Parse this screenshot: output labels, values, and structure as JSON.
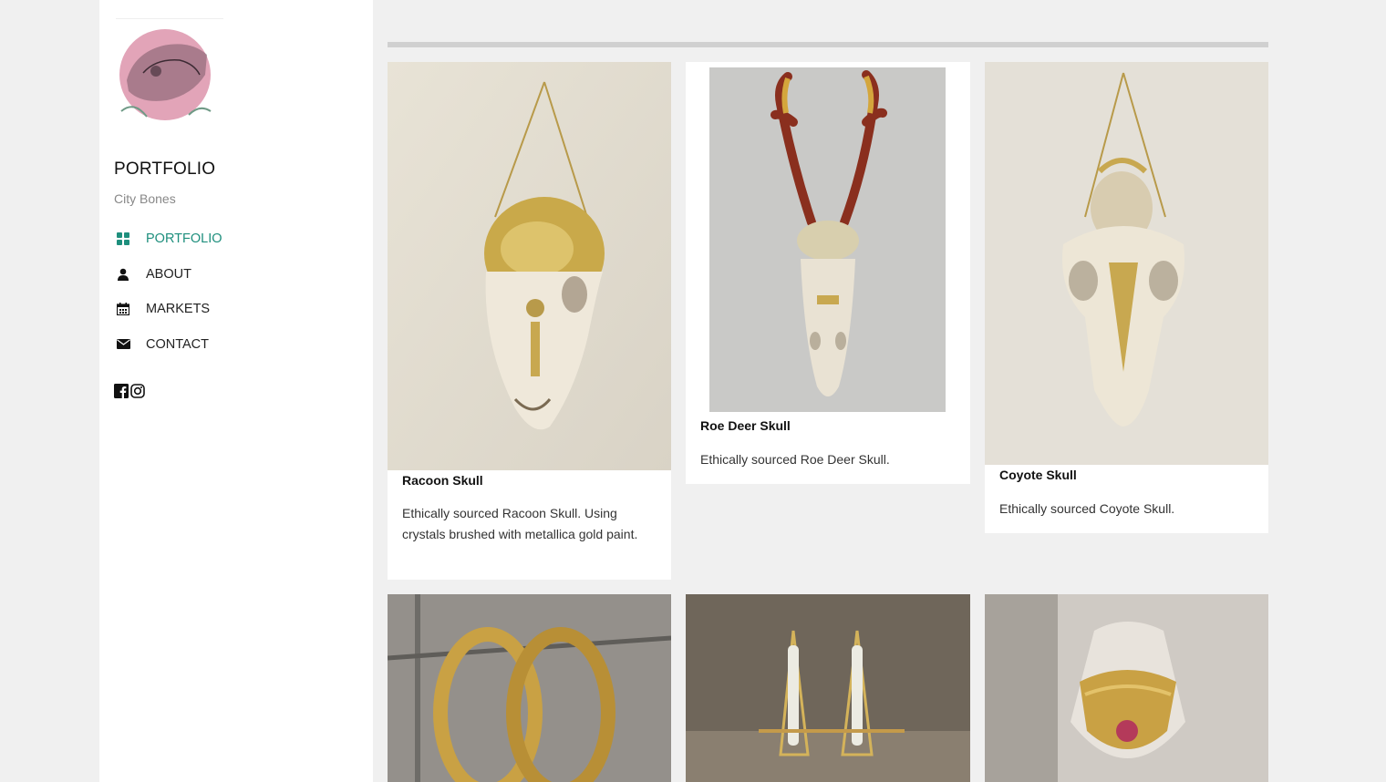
{
  "site": {
    "title": "PORTFOLIO",
    "subtitle": "City Bones",
    "logo_text": "City Bones"
  },
  "nav": [
    {
      "label": "PORTFOLIO",
      "icon": "grid-icon",
      "active": true
    },
    {
      "label": "ABOUT",
      "icon": "user-icon",
      "active": false
    },
    {
      "label": "MARKETS",
      "icon": "calendar-icon",
      "active": false
    },
    {
      "label": "CONTACT",
      "icon": "envelope-icon",
      "active": false
    }
  ],
  "social": [
    "facebook-icon",
    "instagram-icon"
  ],
  "colors": {
    "accent": "#1e8f7d",
    "background": "#f0f0f0"
  },
  "items": [
    {
      "title": "Racoon Skull",
      "description": "Ethically sourced Racoon Skull. Using crystals brushed with metallica gold paint."
    },
    {
      "title": "Roe Deer Skull",
      "description": "Ethically sourced Roe Deer Skull."
    },
    {
      "title": "Coyote Skull",
      "description": "Ethically sourced Coyote Skull."
    }
  ]
}
